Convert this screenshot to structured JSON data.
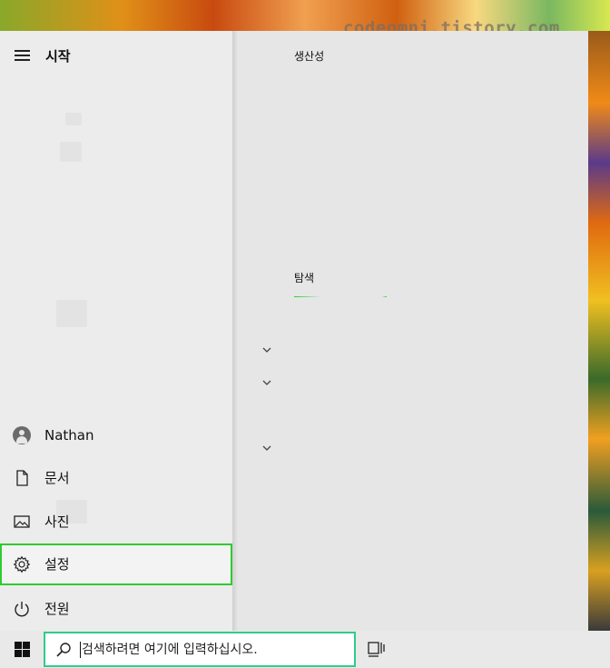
{
  "watermark": "codeomni.tistory.com",
  "start_menu": {
    "title": "시작",
    "side_items": [
      {
        "label": "Nathan",
        "icon": "user-avatar-icon"
      },
      {
        "label": "문서",
        "icon": "document-icon"
      },
      {
        "label": "사진",
        "icon": "picture-icon"
      },
      {
        "label": "설정",
        "icon": "gear-icon",
        "selected": true
      },
      {
        "label": "전원",
        "icon": "power-icon"
      }
    ],
    "tile_groups": [
      {
        "label": "생산성"
      },
      {
        "label": "탐색"
      }
    ],
    "accent_color": "#2ecc2e"
  },
  "taskbar": {
    "start_icon": "windows-logo-icon",
    "search": {
      "placeholder": "검색하려면 여기에 입력하십시오.",
      "icon": "search-icon"
    },
    "task_view_icon": "task-view-icon"
  }
}
